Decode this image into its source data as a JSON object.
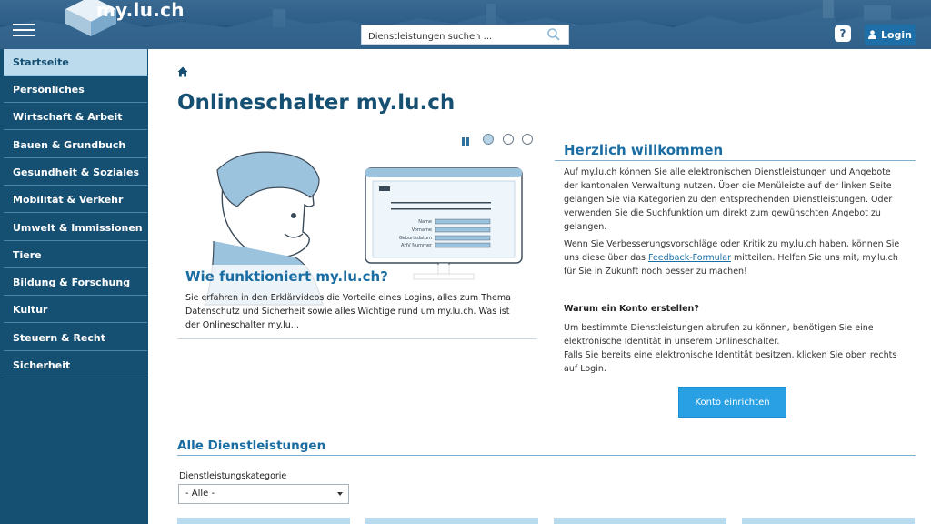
{
  "header": {
    "logo": "my.lu.ch",
    "search_placeholder": "Dienstleistungen suchen ...",
    "help_label": "?",
    "login_label": "Login"
  },
  "sidebar": {
    "items": [
      {
        "label": "Startseite",
        "active": true
      },
      {
        "label": "Persönliches"
      },
      {
        "label": "Wirtschaft & Arbeit"
      },
      {
        "label": "Bauen & Grundbuch"
      },
      {
        "label": "Gesundheit & Soziales"
      },
      {
        "label": "Mobilität & Verkehr"
      },
      {
        "label": "Umwelt & Immissionen"
      },
      {
        "label": "Tiere"
      },
      {
        "label": "Bildung & Forschung"
      },
      {
        "label": "Kultur"
      },
      {
        "label": "Steuern & Recht"
      },
      {
        "label": "Sicherheit"
      }
    ]
  },
  "main": {
    "title": "Onlineschalter my.lu.ch",
    "carousel": {
      "title": "Wie funktioniert my.lu.ch?",
      "text": "Sie erfahren in den Erklärvideos die Vorteile eines Logins, alles zum Thema Datenschutz und Sicherheit sowie alles Wichtige rund um my.lu.ch. Was ist der Onlineschalter my.lu...",
      "form_labels": [
        "Name",
        "Vorname",
        "Geburtsdatum",
        "AHV Nummer"
      ],
      "slides": 3,
      "active_slide": 1
    },
    "welcome": {
      "title": "Herzlich willkommen",
      "para1": "Auf my.lu.ch können Sie alle elektronischen Dienstleistungen und Angebote der kantonalen Verwaltung nutzen. Über die Menüleiste auf der linken Seite gelangen Sie via Kategorien zu den entsprechenden Dienstleistungen. Oder verwenden Sie die Suchfunktion um direkt zum gewünschten Angebot zu gelangen.",
      "para2_before": "Wenn Sie Verbesserungsvorschläge oder Kritik zu my.lu.ch haben, können Sie uns diese über das ",
      "para2_link": "Feedback-Formular",
      "para2_after": " mitteilen. Helfen Sie uns mit, my.lu.ch für Sie in Zukunft noch besser zu machen!",
      "konto_heading": "Warum ein Konto erstellen?",
      "konto_text1": "Um bestimmte Dienstleistungen abrufen zu können, benötigen Sie eine elektronische Identität in unserem Onlineschalter.",
      "konto_text2": "Falls Sie bereits eine elektronische Identität besitzen, klicken Sie oben rechts auf Login.",
      "konto_button": "Konto einrichten"
    },
    "services": {
      "title": "Alle Dienstleistungen",
      "filter_label": "Dienstleistungskategorie",
      "filter_value": "- Alle -"
    }
  },
  "colors": {
    "header": "#2b5c86",
    "sidebar": "#154f72",
    "sidebar_active": "#bcdcee",
    "accent": "#1a6da3",
    "button": "#2aa0e4"
  }
}
